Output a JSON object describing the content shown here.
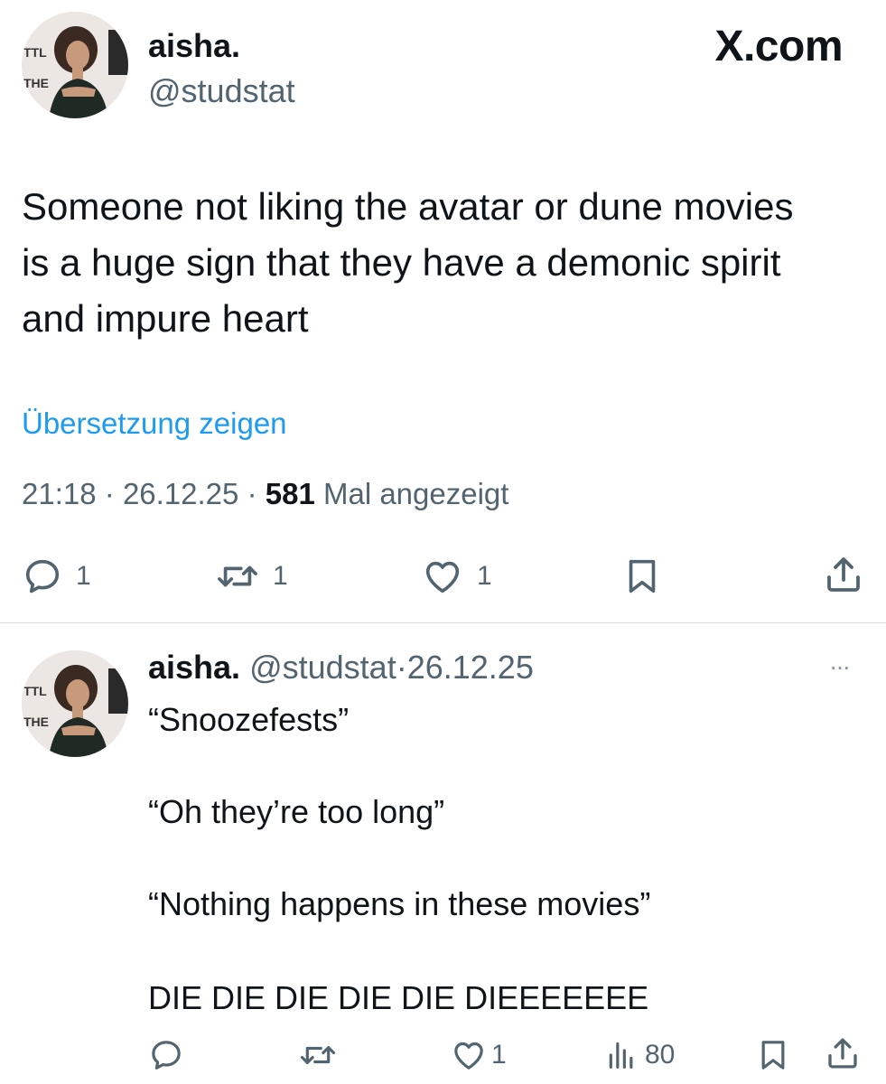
{
  "brand": {
    "label": "X.com"
  },
  "tweet": {
    "author": {
      "display_name": "aisha.",
      "handle": "@studstat"
    },
    "text_lines": [
      "Someone not liking the avatar or dune movies",
      "is a huge sign that they have a demonic spirit",
      "and impure heart"
    ],
    "translate_link": "Übersetzung zeigen",
    "time": "21:18",
    "date": "26.12.25",
    "sep": "·",
    "views_count": "581",
    "views_label": "Mal angezeigt",
    "actions": {
      "reply_count": "1",
      "retweet_count": "1",
      "like_count": "1"
    }
  },
  "reply": {
    "author": {
      "display_name": "aisha.",
      "handle": "@studstat"
    },
    "sep": "·",
    "date": "26.12.25",
    "more_label": "···",
    "text_lines": [
      "“Snoozefests”",
      "“Oh they’re too long”",
      "“Nothing happens in these movies”",
      "DIE DIE DIE DIE DIE DIEEEEEEE"
    ],
    "actions": {
      "like_count": "1",
      "views_count": "80"
    }
  },
  "colors": {
    "text": "#0f1419",
    "muted": "#536471",
    "link": "#1d9bf0",
    "divider": "#dcdfe2"
  }
}
